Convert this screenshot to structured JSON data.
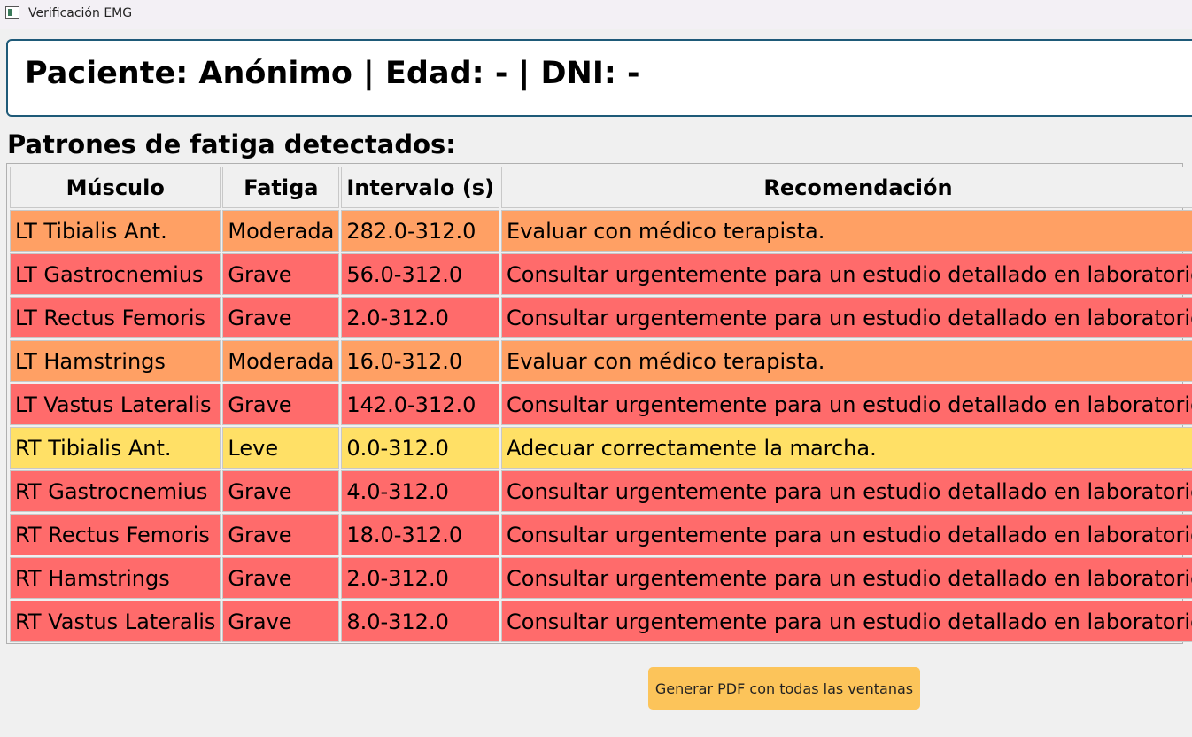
{
  "window": {
    "title": "Verificación EMG",
    "icon": "app-window-icon"
  },
  "patient": {
    "header": "Paciente: Anónimo | Edad: - | DNI: -"
  },
  "section_title": "Patrones de fatiga detectados:",
  "table": {
    "headers": [
      "Músculo",
      "Fatiga",
      "Intervalo (s)",
      "Recomendación"
    ],
    "severity_colors": {
      "Grave": "#ff6b6b",
      "Moderada": "#ffa064",
      "Leve": "#ffe066"
    },
    "rows": [
      {
        "muscle": "LT Tibialis Ant.",
        "fatigue": "Moderada",
        "interval": "282.0-312.0",
        "recommendation": "Evaluar con médico terapista."
      },
      {
        "muscle": "LT Gastrocnemius",
        "fatigue": "Grave",
        "interval": "56.0-312.0",
        "recommendation": "Consultar urgentemente para un estudio detallado en laboratorio."
      },
      {
        "muscle": "LT Rectus Femoris",
        "fatigue": "Grave",
        "interval": "2.0-312.0",
        "recommendation": "Consultar urgentemente para un estudio detallado en laboratorio."
      },
      {
        "muscle": "LT Hamstrings",
        "fatigue": "Moderada",
        "interval": "16.0-312.0",
        "recommendation": "Evaluar con médico terapista."
      },
      {
        "muscle": "LT Vastus Lateralis",
        "fatigue": "Grave",
        "interval": "142.0-312.0",
        "recommendation": "Consultar urgentemente para un estudio detallado en laboratorio."
      },
      {
        "muscle": "RT Tibialis Ant.",
        "fatigue": "Leve",
        "interval": "0.0-312.0",
        "recommendation": "Adecuar correctamente la marcha."
      },
      {
        "muscle": "RT Gastrocnemius",
        "fatigue": "Grave",
        "interval": "4.0-312.0",
        "recommendation": "Consultar urgentemente para un estudio detallado en laboratorio."
      },
      {
        "muscle": "RT Rectus Femoris",
        "fatigue": "Grave",
        "interval": "18.0-312.0",
        "recommendation": "Consultar urgentemente para un estudio detallado en laboratorio."
      },
      {
        "muscle": "RT Hamstrings",
        "fatigue": "Grave",
        "interval": "2.0-312.0",
        "recommendation": "Consultar urgentemente para un estudio detallado en laboratorio."
      },
      {
        "muscle": "RT Vastus Lateralis",
        "fatigue": "Grave",
        "interval": "8.0-312.0",
        "recommendation": "Consultar urgentemente para un estudio detallado en laboratorio."
      }
    ]
  },
  "actions": {
    "generate_pdf_label": "Generar PDF con todas las ventanas"
  }
}
